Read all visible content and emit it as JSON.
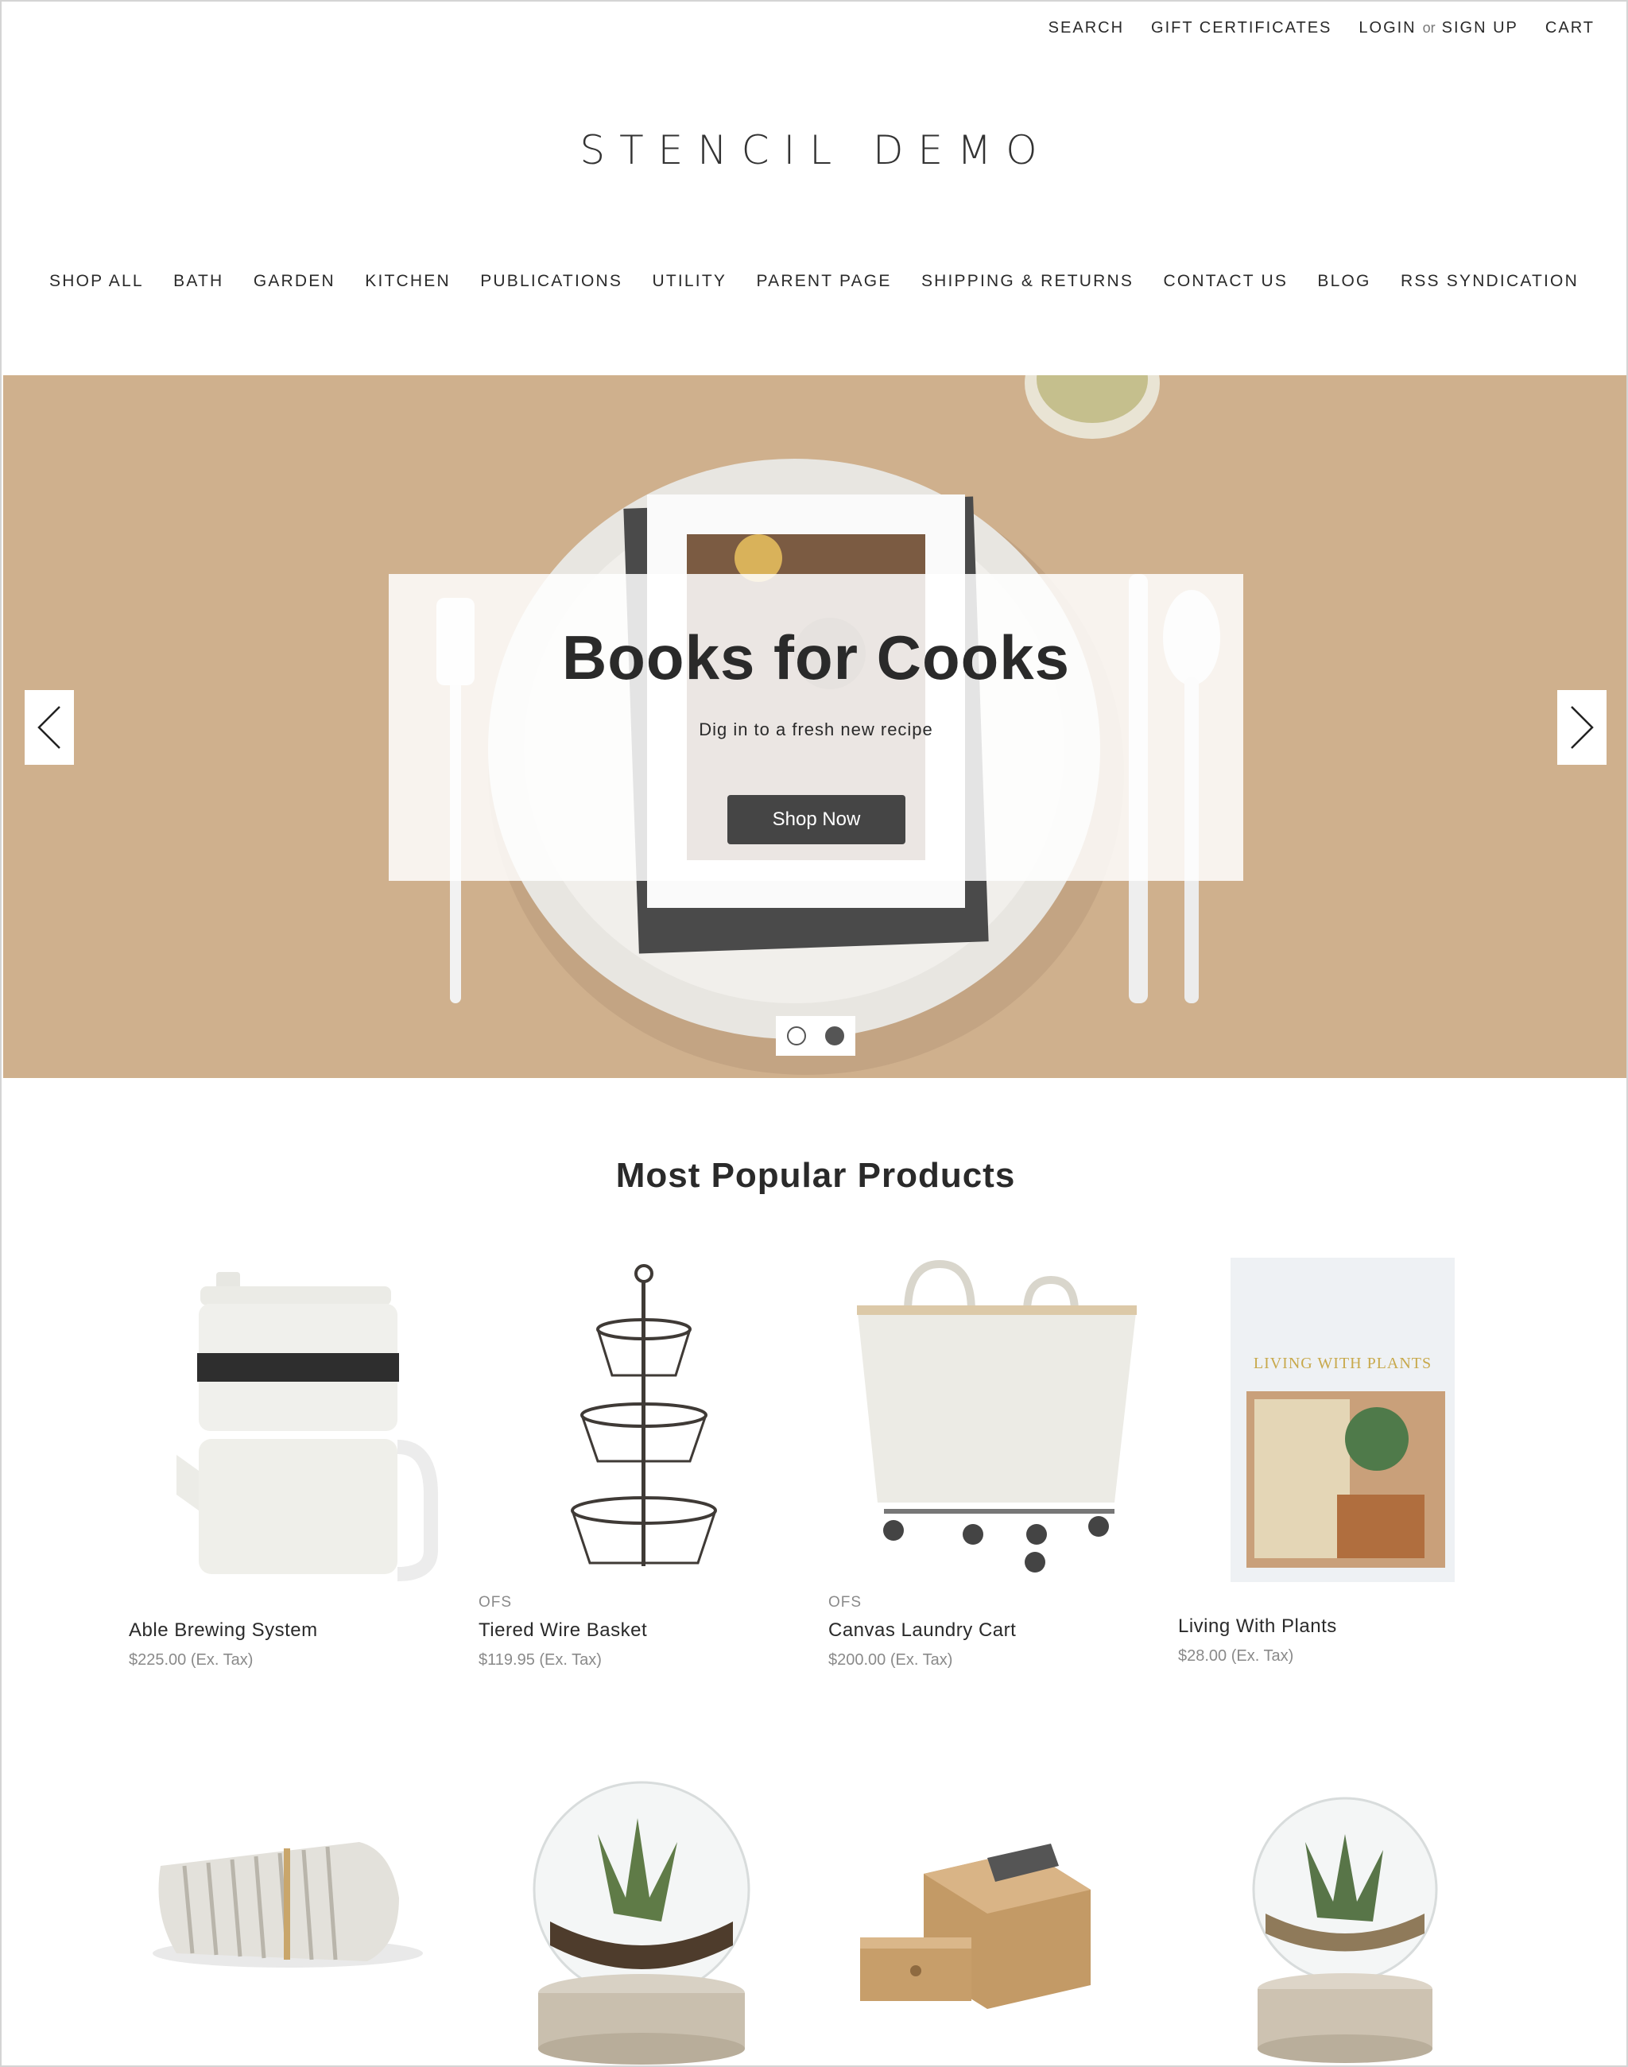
{
  "topnav": {
    "search": "SEARCH",
    "gift": "GIFT CERTIFICATES",
    "login": "LOGIN",
    "or": "or",
    "signup": "SIGN UP",
    "cart": "CART"
  },
  "store": {
    "name": "STENCIL DEMO"
  },
  "nav": {
    "items": [
      "SHOP ALL",
      "BATH",
      "GARDEN",
      "KITCHEN",
      "PUBLICATIONS",
      "UTILITY",
      "PARENT PAGE",
      "SHIPPING & RETURNS",
      "CONTACT US",
      "BLOG",
      "RSS SYNDICATION"
    ]
  },
  "hero": {
    "title": "Books for Cooks",
    "subtitle": "Dig in to a fresh new recipe",
    "button": "Shop Now",
    "background_color": "#cfb08d",
    "prev_icon": "chevron-left-icon",
    "next_icon": "chevron-right-icon",
    "slide_count": 2,
    "active_slide": 2
  },
  "popular": {
    "title": "Most Popular Products",
    "products": [
      {
        "brand": "",
        "name": "Able Brewing System",
        "price": "$225.00 (Ex. Tax)",
        "image": "teapot"
      },
      {
        "brand": "OFS",
        "name": "Tiered Wire Basket",
        "price": "$119.95 (Ex. Tax)",
        "image": "wire-basket"
      },
      {
        "brand": "OFS",
        "name": "Canvas Laundry Cart",
        "price": "$200.00 (Ex. Tax)",
        "image": "laundry-cart"
      },
      {
        "brand": "",
        "name": "Living With Plants",
        "price": "$28.00 (Ex. Tax)",
        "image": "book-cover",
        "cover_title": "LIVING WITH PLANTS"
      }
    ],
    "more_products": [
      {
        "image": "rolled-towel"
      },
      {
        "image": "terrarium-large"
      },
      {
        "image": "wooden-box"
      },
      {
        "image": "terrarium-small"
      }
    ]
  }
}
